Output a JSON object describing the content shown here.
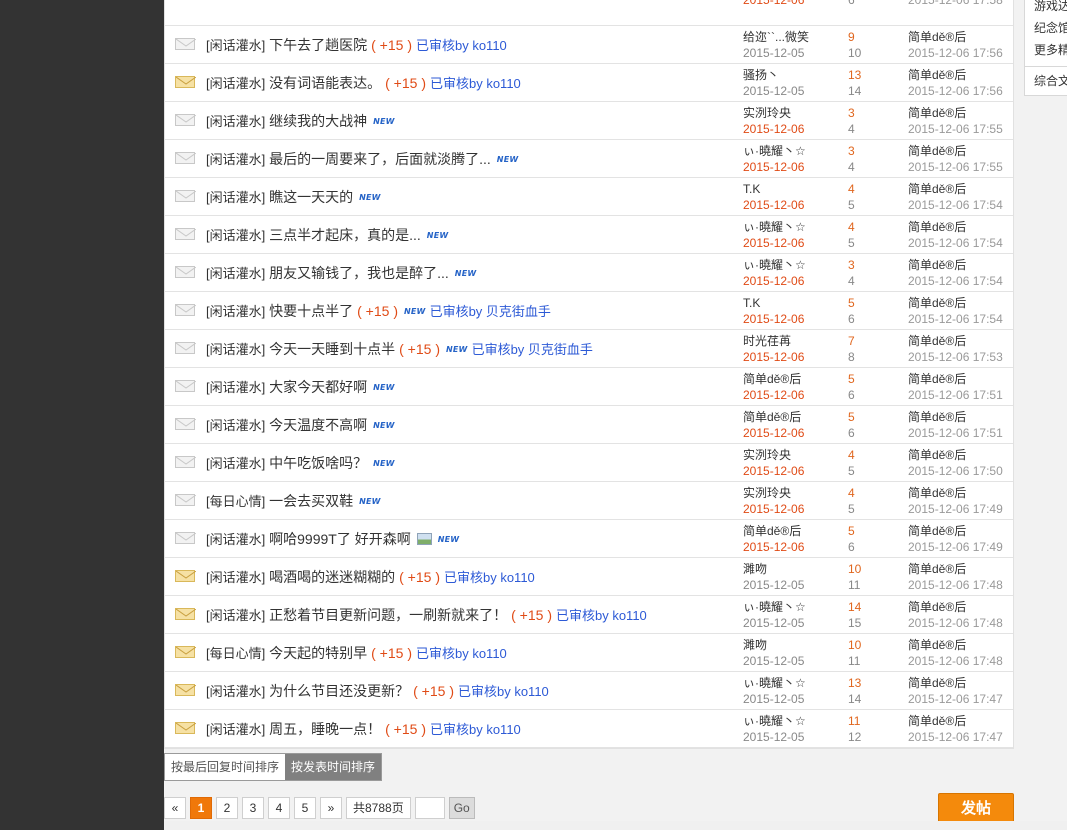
{
  "partial_top_row": {
    "views": "6",
    "time": "2015-12-06 17:58",
    "date": "2015-12-06"
  },
  "sidebar": {
    "items": [
      "游戏达",
      "纪念馆",
      "更多精",
      "综合文"
    ]
  },
  "threads": [
    {
      "tag": "[闲话灌水]",
      "subject": "下午去了趟医院",
      "plus": "( +15 )",
      "audit": "已审核by ko110",
      "new": false,
      "img": false,
      "hot": false,
      "author": "给迩``...微笑",
      "date": "2015-12-05",
      "date_today": false,
      "replies": "9",
      "views": "10",
      "last_user": "简单dě®后",
      "last_time": "2015-12-06 17:56"
    },
    {
      "tag": "[闲话灌水]",
      "subject": "没有词语能表达。",
      "plus": "( +15 )",
      "audit": "已审核by ko110",
      "new": false,
      "img": false,
      "hot": true,
      "author": "骚扬丶",
      "date": "2015-12-05",
      "date_today": false,
      "replies": "13",
      "views": "14",
      "last_user": "简单dě®后",
      "last_time": "2015-12-06 17:56"
    },
    {
      "tag": "[闲话灌水]",
      "subject": "继续我的大战神",
      "plus": "",
      "audit": "",
      "new": true,
      "img": false,
      "hot": false,
      "author": "实洌玲央",
      "date": "2015-12-06",
      "date_today": true,
      "replies": "3",
      "views": "4",
      "last_user": "简单dě®后",
      "last_time": "2015-12-06 17:55"
    },
    {
      "tag": "[闲话灌水]",
      "subject": "最后的一周要来了，后面就淡腾了...",
      "plus": "",
      "audit": "",
      "new": true,
      "img": false,
      "hot": false,
      "author": "ぃ·曉耀丶☆",
      "date": "2015-12-06",
      "date_today": true,
      "replies": "3",
      "views": "4",
      "last_user": "简单dě®后",
      "last_time": "2015-12-06 17:55"
    },
    {
      "tag": "[闲话灌水]",
      "subject": "瞧这一天天的",
      "plus": "",
      "audit": "",
      "new": true,
      "img": false,
      "hot": false,
      "author": "T.K",
      "date": "2015-12-06",
      "date_today": true,
      "replies": "4",
      "views": "5",
      "last_user": "简单dě®后",
      "last_time": "2015-12-06 17:54"
    },
    {
      "tag": "[闲话灌水]",
      "subject": "三点半才起床，真的是...",
      "plus": "",
      "audit": "",
      "new": true,
      "img": false,
      "hot": false,
      "author": "ぃ·曉耀丶☆",
      "date": "2015-12-06",
      "date_today": true,
      "replies": "4",
      "views": "5",
      "last_user": "简单dě®后",
      "last_time": "2015-12-06 17:54"
    },
    {
      "tag": "[闲话灌水]",
      "subject": "朋友又输钱了，我也是醉了...",
      "plus": "",
      "audit": "",
      "new": true,
      "img": false,
      "hot": false,
      "author": "ぃ·曉耀丶☆",
      "date": "2015-12-06",
      "date_today": true,
      "replies": "3",
      "views": "4",
      "last_user": "简单dě®后",
      "last_time": "2015-12-06 17:54"
    },
    {
      "tag": "[闲话灌水]",
      "subject": "快要十点半了",
      "plus": "( +15 )",
      "audit": "已审核by 贝克街血手",
      "new": true,
      "img": false,
      "hot": false,
      "author": "T.K",
      "date": "2015-12-06",
      "date_today": true,
      "replies": "5",
      "views": "6",
      "last_user": "简单dě®后",
      "last_time": "2015-12-06 17:54"
    },
    {
      "tag": "[闲话灌水]",
      "subject": "今天一天睡到十点半",
      "plus": "( +15 )",
      "audit": "已审核by 贝克街血手",
      "new": true,
      "img": false,
      "hot": false,
      "author": "时光荏苒",
      "date": "2015-12-06",
      "date_today": true,
      "replies": "7",
      "views": "8",
      "last_user": "简单dě®后",
      "last_time": "2015-12-06 17:53"
    },
    {
      "tag": "[闲话灌水]",
      "subject": "大家今天都好啊",
      "plus": "",
      "audit": "",
      "new": true,
      "img": false,
      "hot": false,
      "author": "简单dě®后",
      "date": "2015-12-06",
      "date_today": true,
      "replies": "5",
      "views": "6",
      "last_user": "简单dě®后",
      "last_time": "2015-12-06 17:51"
    },
    {
      "tag": "[闲话灌水]",
      "subject": "今天温度不高啊",
      "plus": "",
      "audit": "",
      "new": true,
      "img": false,
      "hot": false,
      "author": "简单dě®后",
      "date": "2015-12-06",
      "date_today": true,
      "replies": "5",
      "views": "6",
      "last_user": "简单dě®后",
      "last_time": "2015-12-06 17:51"
    },
    {
      "tag": "[闲话灌水]",
      "subject": "中午吃饭啥吗？",
      "plus": "",
      "audit": "",
      "new": true,
      "img": false,
      "hot": false,
      "author": "实洌玲央",
      "date": "2015-12-06",
      "date_today": true,
      "replies": "4",
      "views": "5",
      "last_user": "简单dě®后",
      "last_time": "2015-12-06 17:50"
    },
    {
      "tag": "[每日心情]",
      "subject": "一会去买双鞋",
      "plus": "",
      "audit": "",
      "new": true,
      "img": false,
      "hot": false,
      "author": "实洌玲央",
      "date": "2015-12-06",
      "date_today": true,
      "replies": "4",
      "views": "5",
      "last_user": "简单dě®后",
      "last_time": "2015-12-06 17:49"
    },
    {
      "tag": "[闲话灌水]",
      "subject": "啊哈9999T了 好开森啊",
      "plus": "",
      "audit": "",
      "new": true,
      "img": true,
      "hot": false,
      "author": "简单dě®后",
      "date": "2015-12-06",
      "date_today": true,
      "replies": "5",
      "views": "6",
      "last_user": "简单dě®后",
      "last_time": "2015-12-06 17:49"
    },
    {
      "tag": "[闲话灌水]",
      "subject": "喝酒喝的迷迷糊糊的",
      "plus": "( +15 )",
      "audit": "已审核by ko110",
      "new": false,
      "img": false,
      "hot": true,
      "author": "濉吻",
      "date": "2015-12-05",
      "date_today": false,
      "replies": "10",
      "views": "11",
      "last_user": "简单dě®后",
      "last_time": "2015-12-06 17:48"
    },
    {
      "tag": "[闲话灌水]",
      "subject": "正愁着节目更新问题，一刷新就来了！",
      "plus": "( +15 )",
      "audit": "已审核by ko110",
      "new": false,
      "img": false,
      "hot": true,
      "author": "ぃ·曉耀丶☆",
      "date": "2015-12-05",
      "date_today": false,
      "replies": "14",
      "views": "15",
      "last_user": "简单dě®后",
      "last_time": "2015-12-06 17:48"
    },
    {
      "tag": "[每日心情]",
      "subject": "今天起的特别早",
      "plus": "( +15 )",
      "audit": "已审核by ko110",
      "new": false,
      "img": false,
      "hot": true,
      "author": "濉吻",
      "date": "2015-12-05",
      "date_today": false,
      "replies": "10",
      "views": "11",
      "last_user": "简单dě®后",
      "last_time": "2015-12-06 17:48"
    },
    {
      "tag": "[闲话灌水]",
      "subject": "为什么节目还没更新？",
      "plus": "( +15 )",
      "audit": "已审核by ko110",
      "new": false,
      "img": false,
      "hot": true,
      "author": "ぃ·曉耀丶☆",
      "date": "2015-12-05",
      "date_today": false,
      "replies": "13",
      "views": "14",
      "last_user": "简单dě®后",
      "last_time": "2015-12-06 17:47"
    },
    {
      "tag": "[闲话灌水]",
      "subject": "周五，睡晚一点！",
      "plus": "( +15 )",
      "audit": "已审核by ko110",
      "new": false,
      "img": false,
      "hot": true,
      "author": "ぃ·曉耀丶☆",
      "date": "2015-12-05",
      "date_today": false,
      "replies": "11",
      "views": "12",
      "last_user": "简单dě®后",
      "last_time": "2015-12-06 17:47"
    }
  ],
  "new_badge": "NEW",
  "sort": {
    "by_last_reply": "按最后回复时间排序",
    "by_post_time": "按发表时间排序"
  },
  "pager": {
    "prev": "«",
    "pages": [
      "1",
      "2",
      "3",
      "4",
      "5"
    ],
    "next": "»",
    "total": "共8788页",
    "go": "Go"
  },
  "post_button": "发帖",
  "colors": {
    "accent_orange": "#f0780a",
    "plus_red": "#e04b16",
    "audit_blue": "#2d5ad6",
    "left_bar": "#333333"
  }
}
